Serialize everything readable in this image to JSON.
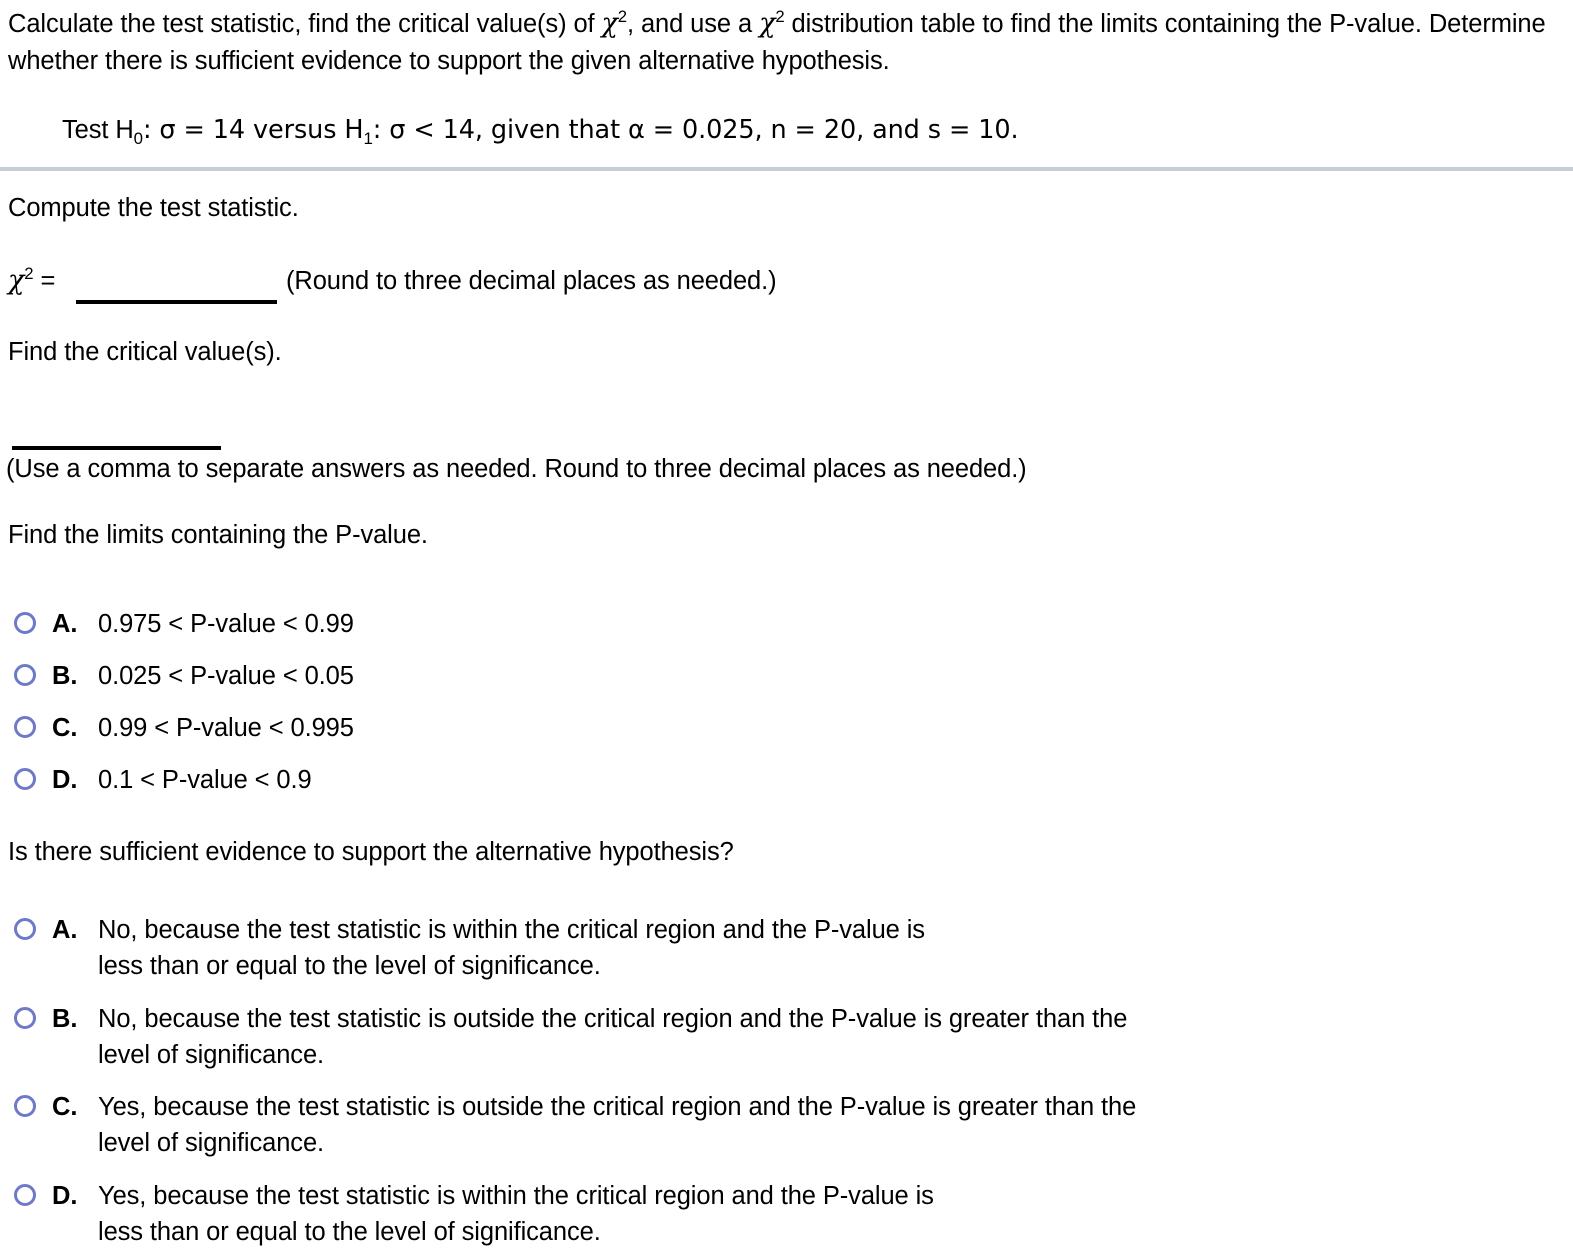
{
  "problem": {
    "statement_part1": "Calculate the test statistic, find the critical value(s) of ",
    "chi_symbol": "χ",
    "chi_exponent": "2",
    "statement_part2": ", and use a ",
    "statement_part3": " distribution table to find the limits containing the P-value. Determine whether there is sufficient evidence to support the given alternative hypothesis.",
    "hypothesis_prefix": "Test H",
    "hypothesis_null_sub": "0",
    "hypothesis_mid": ": σ = 14 versus H",
    "hypothesis_alt_sub": "1",
    "hypothesis_suffix": ": σ < 14, given that α = 0.025, n = 20, and s = 10.",
    "sigma": "σ",
    "alpha": "α",
    "sigma_null_value": "14",
    "sigma_alt_value": "14",
    "alpha_value": "0.025",
    "n_value": "20",
    "s_value": "10"
  },
  "sections": {
    "compute_heading": "Compute the test statistic.",
    "chi_equals_label": "=",
    "chi_rounding_note": "(Round to three decimal places as needed.)",
    "chi_answer_value": "",
    "critical_heading": "Find the critical value(s).",
    "critical_answer_value": "",
    "critical_note": "(Use a comma to separate answers as needed. Round to three decimal places as needed.)",
    "pvalue_heading": "Find the limits containing the P-value.",
    "evidence_heading": "Is there sufficient evidence to support the alternative hypothesis?"
  },
  "pvalue_options": [
    {
      "letter": "A.",
      "text": "0.975 < P-value < 0.99",
      "selected": false
    },
    {
      "letter": "B.",
      "text": "0.025 < P-value < 0.05",
      "selected": false
    },
    {
      "letter": "C.",
      "text": "0.99 < P-value < 0.995",
      "selected": false
    },
    {
      "letter": "D.",
      "text": "0.1 < P-value < 0.9",
      "selected": false
    }
  ],
  "evidence_options": [
    {
      "letter": "A.",
      "text": "No, because the test statistic is within the critical region and the P-value is\nless than or equal to the level of significance.",
      "selected": false
    },
    {
      "letter": "B.",
      "text": "No, because the test statistic is outside the critical region and the P-value is greater than the\nlevel of significance.",
      "selected": false
    },
    {
      "letter": "C.",
      "text": "Yes, because the test statistic is outside the critical region and the P-value is greater than the\nlevel of significance.",
      "selected": false
    },
    {
      "letter": "D.",
      "text": "Yes, because the test statistic is within the critical region and the P-value is\nless than or equal to the level of significance.",
      "selected": false
    }
  ],
  "colors": {
    "divider": "#c5cdd8",
    "radio_border": "#6f79c9",
    "text": "#000000",
    "background": "#ffffff"
  }
}
